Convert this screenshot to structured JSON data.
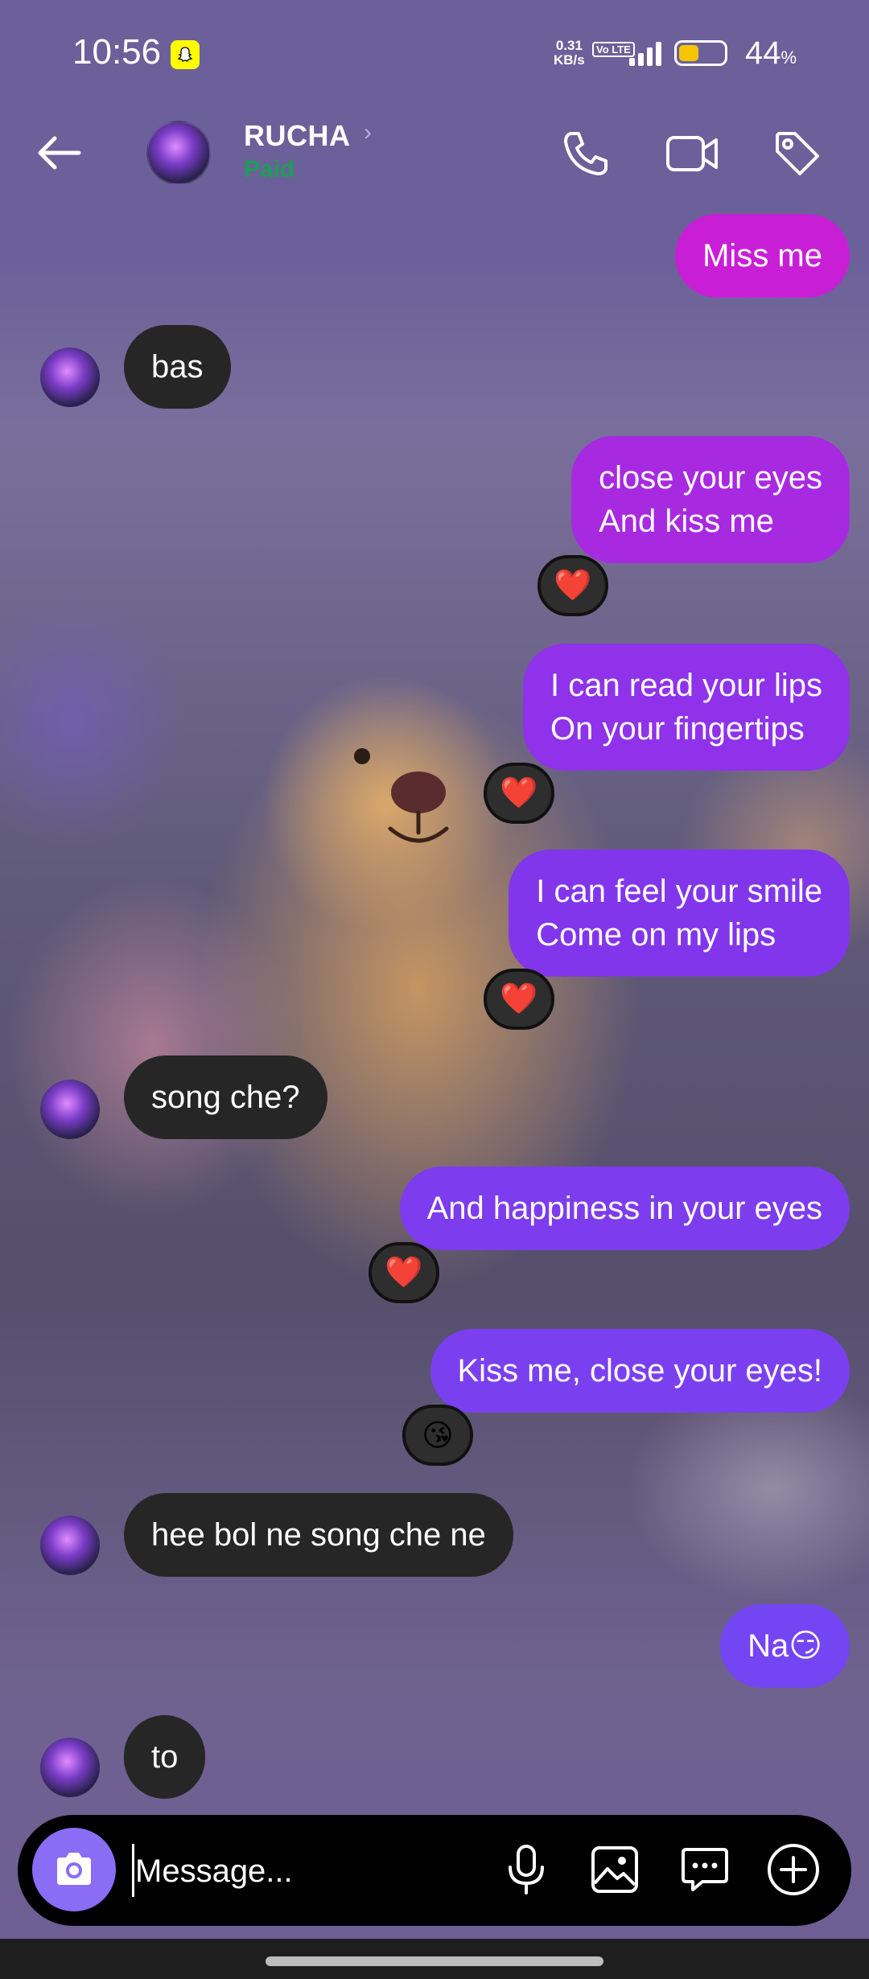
{
  "status_bar": {
    "time": "10:56",
    "net_speed_value": "0.31",
    "net_speed_unit": "KB/s",
    "volte": "Vo LTE",
    "battery_pct": "44",
    "battery_suffix": "%",
    "battery_level": 0.44,
    "battery_color": "#f7c500"
  },
  "header": {
    "contact_name": "RUCHA",
    "contact_status": "Paid",
    "status_color": "#1f9c56",
    "icons": [
      "back-arrow-icon",
      "phone-icon",
      "video-camera-icon",
      "tag-icon"
    ]
  },
  "messages": [
    {
      "dir": "out",
      "lines": [
        "Miss me"
      ],
      "color": "#c81fd6"
    },
    {
      "dir": "in",
      "lines": [
        "bas"
      ]
    },
    {
      "dir": "out",
      "lines": [
        "close your eyes",
        "And kiss me"
      ],
      "reaction": "❤️",
      "color": "#a82ae0"
    },
    {
      "dir": "out",
      "lines": [
        "I can read your lips",
        "On your fingertips"
      ],
      "reaction": "❤️",
      "color": "#8f32ea"
    },
    {
      "dir": "out",
      "lines": [
        "I can feel your smile",
        "Come on my lips"
      ],
      "reaction": "❤️",
      "color": "#8236ec"
    },
    {
      "dir": "in",
      "lines": [
        "song che?"
      ]
    },
    {
      "dir": "out",
      "lines": [
        "And happiness in your eyes"
      ],
      "reaction": "❤️",
      "color": "#7d3cee"
    },
    {
      "dir": "out",
      "lines": [
        "Kiss me, close your eyes!"
      ],
      "reaction": "😘",
      "color": "#7a40f0"
    },
    {
      "dir": "in",
      "lines": [
        "hee bol ne song che ne"
      ]
    },
    {
      "dir": "out",
      "lines": [
        "Na😏"
      ],
      "color": "#7445f2"
    },
    {
      "dir": "in",
      "lines": [
        "to"
      ]
    }
  ],
  "composer": {
    "placeholder": "Message...",
    "icons": [
      "camera-icon",
      "microphone-icon",
      "gallery-icon",
      "sticker-icon",
      "plus-icon"
    ],
    "camera_color": "#8b6cf5"
  }
}
